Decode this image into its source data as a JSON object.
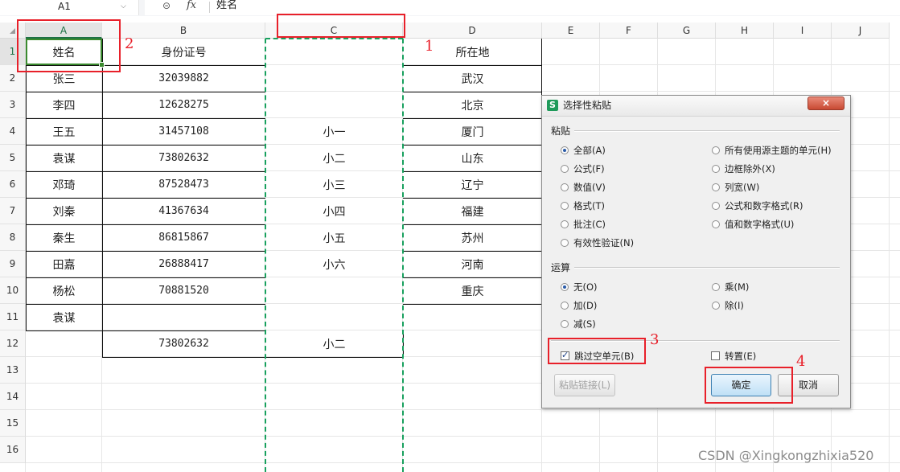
{
  "formula_bar": {
    "cell_ref": "A1",
    "chevron_icon": "chevron-down-icon",
    "zoom_icon": "zoom-icon",
    "fx_label": "fx",
    "content": "姓名"
  },
  "columns": [
    "A",
    "B",
    "C",
    "D",
    "E",
    "F",
    "G",
    "H",
    "I",
    "J"
  ],
  "rows": [
    "1",
    "2",
    "3",
    "4",
    "5",
    "6",
    "7",
    "8",
    "9",
    "10",
    "11",
    "12",
    "13",
    "14",
    "15",
    "16"
  ],
  "table": {
    "headers": [
      "姓名",
      "身份证号",
      "",
      "所在地"
    ],
    "body": [
      [
        "张三",
        "32039882",
        "",
        "武汉"
      ],
      [
        "李四",
        "12628275",
        "",
        "北京"
      ],
      [
        "王五",
        "31457108",
        "小一",
        "厦门"
      ],
      [
        "袁谋",
        "73802632",
        "小二",
        "山东"
      ],
      [
        "邓琦",
        "87528473",
        "小三",
        "辽宁"
      ],
      [
        "刘秦",
        "41367634",
        "小四",
        "福建"
      ],
      [
        "秦生",
        "86815867",
        "小五",
        "苏州"
      ],
      [
        "田嘉",
        "26888417",
        "小六",
        "河南"
      ],
      [
        "杨松",
        "70881520",
        "",
        "重庆"
      ],
      [
        "袁谋",
        "",
        "",
        ""
      ],
      [
        "",
        "73802632",
        "小二",
        ""
      ]
    ]
  },
  "annotations": [
    "1",
    "2",
    "3",
    "4"
  ],
  "dialog": {
    "title": "选择性粘贴",
    "logo": "S",
    "close_icon": "close-icon",
    "close_label": "×",
    "paste_group": "粘贴",
    "paste_left": [
      "全部(A)",
      "公式(F)",
      "数值(V)",
      "格式(T)",
      "批注(C)",
      "有效性验证(N)"
    ],
    "paste_right": [
      "所有使用源主题的单元(H)",
      "边框除外(X)",
      "列宽(W)",
      "公式和数字格式(R)",
      "值和数字格式(U)"
    ],
    "paste_selected": "全部(A)",
    "operation_group": "运算",
    "operation_left": [
      "无(O)",
      "加(D)",
      "减(S)"
    ],
    "operation_right": [
      "乘(M)",
      "除(I)"
    ],
    "operation_selected": "无(O)",
    "skip_blanks_label": "跳过空单元(B)",
    "skip_blanks_checked": true,
    "transpose_label": "转置(E)",
    "transpose_checked": false,
    "paste_link_label": "粘贴链接(L)",
    "ok_label": "确定",
    "cancel_label": "取消"
  },
  "colors": {
    "accent_green": "#1f9a5a",
    "annotation_red": "#e8202a",
    "selection_green": "#3a8a2e"
  },
  "watermark": "CSDN @Xingkongzhixia520"
}
